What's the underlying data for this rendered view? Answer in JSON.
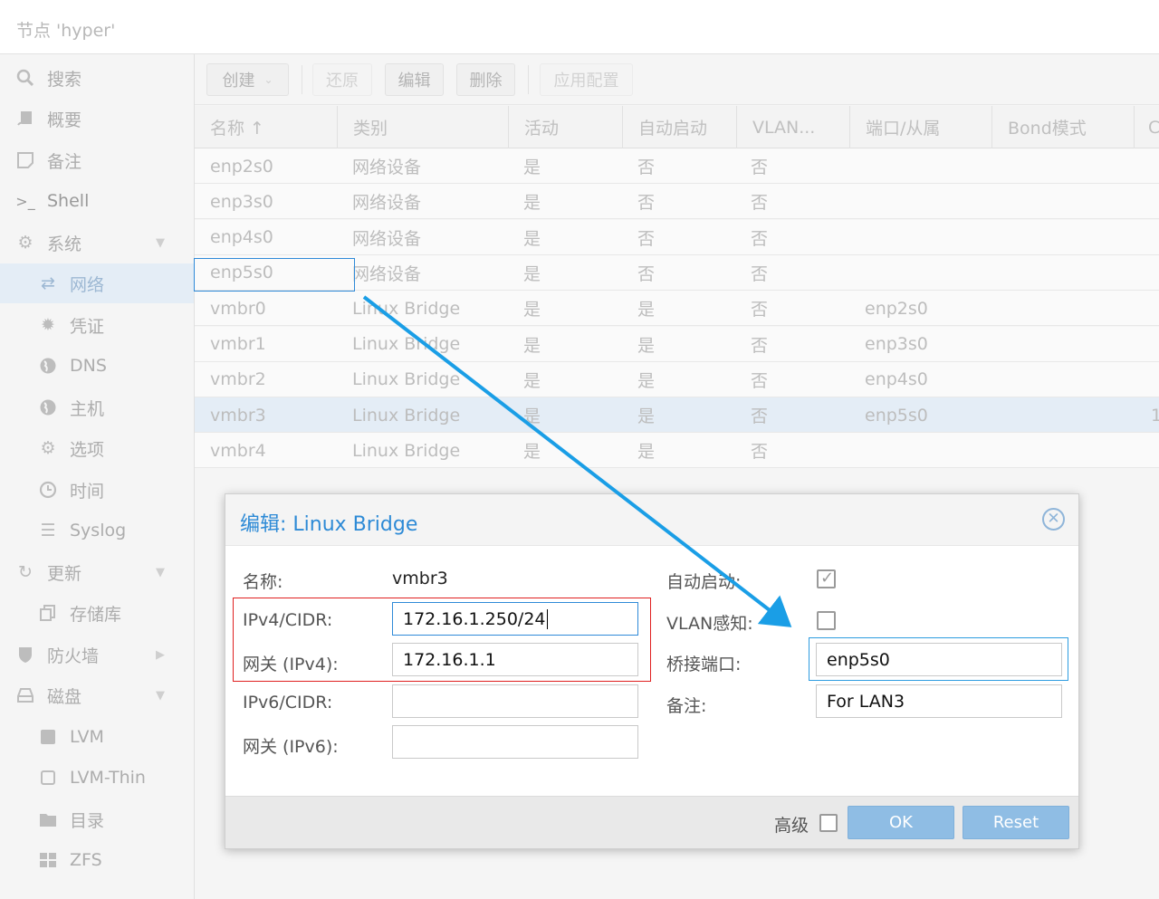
{
  "header": {
    "title": "节点 'hyper'"
  },
  "sidebar": {
    "items": [
      {
        "label": "搜索",
        "icon": "search-icon"
      },
      {
        "label": "概要",
        "icon": "book-icon"
      },
      {
        "label": "备注",
        "icon": "note-icon"
      },
      {
        "label": "Shell",
        "icon": "terminal-icon"
      },
      {
        "label": "系统",
        "icon": "cogs-icon"
      },
      {
        "label": "网络",
        "icon": "exchange-icon"
      },
      {
        "label": "凭证",
        "icon": "certificate-icon"
      },
      {
        "label": "DNS",
        "icon": "globe-icon"
      },
      {
        "label": "主机",
        "icon": "globe-icon"
      },
      {
        "label": "选项",
        "icon": "gear-icon"
      },
      {
        "label": "时间",
        "icon": "clock-icon"
      },
      {
        "label": "Syslog",
        "icon": "list-icon"
      },
      {
        "label": "更新",
        "icon": "refresh-icon"
      },
      {
        "label": "存储库",
        "icon": "files-icon"
      },
      {
        "label": "防火墙",
        "icon": "shield-icon"
      },
      {
        "label": "磁盘",
        "icon": "hdd-icon"
      },
      {
        "label": "LVM",
        "icon": "square-icon"
      },
      {
        "label": "LVM-Thin",
        "icon": "square-outline-icon"
      },
      {
        "label": "目录",
        "icon": "folder-icon"
      },
      {
        "label": "ZFS",
        "icon": "grid-icon"
      }
    ]
  },
  "toolbar": {
    "create_label": "创建",
    "revert_label": "还原",
    "edit_label": "编辑",
    "delete_label": "删除",
    "apply_label": "应用配置"
  },
  "grid": {
    "columns": [
      "名称 ↑",
      "类别",
      "活动",
      "自动启动",
      "VLAN...",
      "端口/从属",
      "Bond模式",
      "C"
    ],
    "rows": [
      {
        "name": "enp2s0",
        "type": "网络设备",
        "active": "是",
        "autostart": "否",
        "vlan": "否",
        "ports": "",
        "bond": "",
        "extra": ""
      },
      {
        "name": "enp3s0",
        "type": "网络设备",
        "active": "是",
        "autostart": "否",
        "vlan": "否",
        "ports": "",
        "bond": "",
        "extra": ""
      },
      {
        "name": "enp4s0",
        "type": "网络设备",
        "active": "是",
        "autostart": "否",
        "vlan": "否",
        "ports": "",
        "bond": "",
        "extra": ""
      },
      {
        "name": "enp5s0",
        "type": "网络设备",
        "active": "是",
        "autostart": "否",
        "vlan": "否",
        "ports": "",
        "bond": "",
        "extra": ""
      },
      {
        "name": "vmbr0",
        "type": "Linux Bridge",
        "active": "是",
        "autostart": "是",
        "vlan": "否",
        "ports": "enp2s0",
        "bond": "",
        "extra": ""
      },
      {
        "name": "vmbr1",
        "type": "Linux Bridge",
        "active": "是",
        "autostart": "是",
        "vlan": "否",
        "ports": "enp3s0",
        "bond": "",
        "extra": ""
      },
      {
        "name": "vmbr2",
        "type": "Linux Bridge",
        "active": "是",
        "autostart": "是",
        "vlan": "否",
        "ports": "enp4s0",
        "bond": "",
        "extra": ""
      },
      {
        "name": "vmbr3",
        "type": "Linux Bridge",
        "active": "是",
        "autostart": "是",
        "vlan": "否",
        "ports": "enp5s0",
        "bond": "",
        "extra": "1"
      },
      {
        "name": "vmbr4",
        "type": "Linux Bridge",
        "active": "是",
        "autostart": "是",
        "vlan": "否",
        "ports": "",
        "bond": "",
        "extra": ""
      }
    ]
  },
  "dialog": {
    "title": "编辑: Linux Bridge",
    "name_label": "名称:",
    "name_value": "vmbr3",
    "ipv4_label": "IPv4/CIDR:",
    "ipv4_value": "172.16.1.250/24",
    "gw4_label": "网关 (IPv4):",
    "gw4_value": "172.16.1.1",
    "ipv6_label": "IPv6/CIDR:",
    "ipv6_value": "",
    "gw6_label": "网关 (IPv6):",
    "gw6_value": "",
    "autostart_label": "自动启动:",
    "autostart_checked": true,
    "vlan_label": "VLAN感知:",
    "vlan_checked": false,
    "bridge_ports_label": "桥接端口:",
    "bridge_ports_value": "enp5s0",
    "comment_label": "备注:",
    "comment_value": "For LAN3",
    "advanced_label": "高级",
    "ok_label": "OK",
    "reset_label": "Reset"
  },
  "annotation": {
    "highlight_red": "#e02020",
    "highlight_blue": "#2d9ce0",
    "arrow_color": "#1a9ee6"
  }
}
